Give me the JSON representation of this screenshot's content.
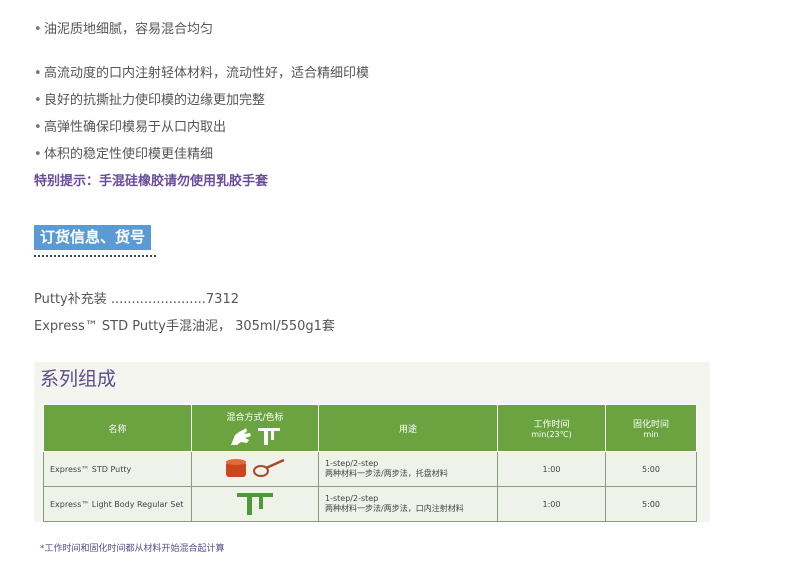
{
  "features_top": [
    "油泥质地细腻，容易混合均匀"
  ],
  "features": [
    "高流动度的口内注射轻体材料，流动性好，适合精细印模",
    "良好的抗撕扯力使印模的边缘更加完整",
    "高弹性确保印模易于从口内取出",
    "体积的稳定性使印模更佳精细"
  ],
  "tip": "特别提示：手混硅橡胶请勿使用乳胶手套",
  "order": {
    "title": "订货信息、货号",
    "lines": [
      "Putty补充装 .......................7312",
      "Express™ STD Putty手混油泥， 305ml/550g1套"
    ]
  },
  "series": {
    "title": "系列组成",
    "headers": {
      "name": "名称",
      "mix": "混合方式/色标",
      "use": "用途",
      "work": "工作时间",
      "work_sub": "min(23℃)",
      "set": "固化时间",
      "set_sub": "min"
    },
    "rows": [
      {
        "name": "Express™ STD Putty",
        "use_1": "1-step/2-step",
        "use_2": "两种材料一步法/两步法，托盘材料",
        "work": "1:00",
        "set": "5:00"
      },
      {
        "name": "Express™ Light Body Regular Set",
        "use_1": "1-step/2-step",
        "use_2": "两种材料一步法/两步法，口内注射材料",
        "work": "1:00",
        "set": "5:00"
      }
    ],
    "footnote": "*工作时间和固化时间都从材料开始混合起计算"
  },
  "colors": {
    "header_green": "#6aa340",
    "cell_bg": "#eef2e9",
    "accent_purple": "#6a4c9c",
    "order_blue": "#5b9bd5",
    "putty_red": "#c9471c",
    "dispenser_green": "#4e9a3b"
  },
  "icons": [
    "hand-mix-icon",
    "dispenser-gun-icon",
    "putty-jar-icon",
    "measuring-spoon-icon",
    "dispenser-gun-green-icon"
  ]
}
